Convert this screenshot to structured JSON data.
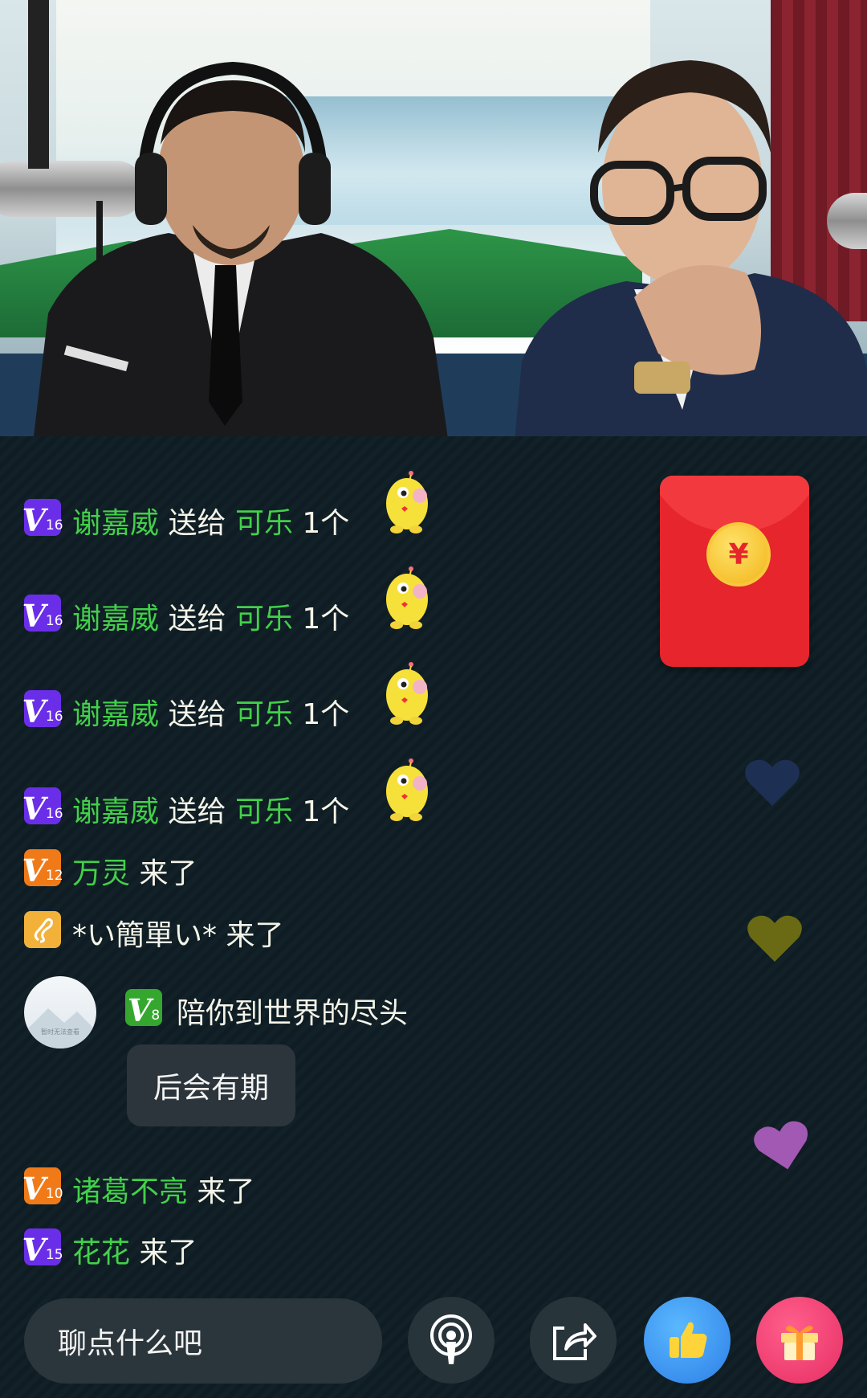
{
  "video": {
    "description_icons": [
      "microphone",
      "headphones"
    ]
  },
  "gift_messages": [
    {
      "level": "16",
      "user": "谢嘉威",
      "action": "送给",
      "recipient": "可乐",
      "count": "1个"
    },
    {
      "level": "16",
      "user": "谢嘉威",
      "action": "送给",
      "recipient": "可乐",
      "count": "1个"
    },
    {
      "level": "16",
      "user": "谢嘉威",
      "action": "送给",
      "recipient": "可乐",
      "count": "1个"
    },
    {
      "level": "16",
      "user": "谢嘉威",
      "action": "送给",
      "recipient": "可乐",
      "count": "1个"
    }
  ],
  "join_messages": [
    {
      "level": "12",
      "user": "万灵",
      "action": "来了",
      "badge_color": "#f07a18"
    },
    {
      "level": "",
      "user": "*い簡單い*",
      "action": "来了",
      "badge_color": "#f2b23a"
    },
    {
      "level": "10",
      "user": "诸葛不亮",
      "action": "来了",
      "badge_color": "#f07a18"
    },
    {
      "level": "15",
      "user": "花花",
      "action": "来了",
      "badge_color": "#6a2ee8"
    }
  ],
  "chat_message": {
    "level": "8",
    "user": "陪你到世界的尽头",
    "avatar_caption": "暂时无法查看",
    "text": "后会有期"
  },
  "red_packet": {
    "symbol": "¥"
  },
  "bottom_bar": {
    "input_placeholder": "聊点什么吧"
  },
  "colors": {
    "nickname": "#43d04a",
    "text": "#f4f4e8",
    "background": "#0f1b22",
    "red_packet": "#e6252c"
  }
}
